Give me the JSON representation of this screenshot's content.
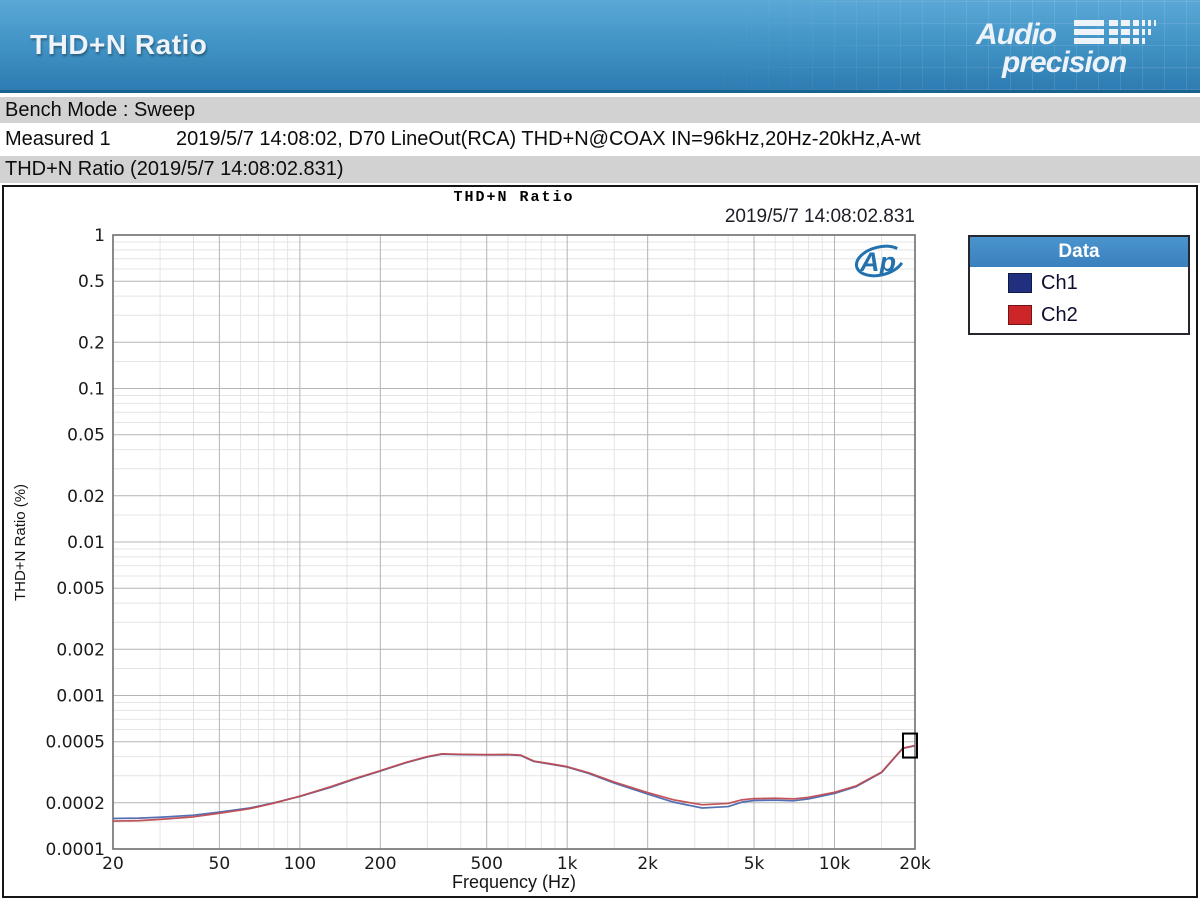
{
  "header": {
    "title": "THD+N Ratio",
    "logo_line1": "Audio",
    "logo_line2": "precision"
  },
  "info_bars": {
    "bench_mode": "Bench Mode : Sweep",
    "measured_label": "Measured 1",
    "measured_text": "2019/5/7 14:08:02, D70 LineOut(RCA) THD+N@COAX IN=96kHz,20Hz-20kHz,A-wt",
    "result_title": "THD+N Ratio (2019/5/7 14:08:02.831)"
  },
  "chart": {
    "title": "THD+N Ratio",
    "timestamp": "2019/5/7 14:08:02.831",
    "watermark": "Ap",
    "legend": {
      "header": "Data",
      "items": [
        {
          "label": "Ch1",
          "color": "#20307f"
        },
        {
          "label": "Ch2",
          "color": "#cc2629"
        }
      ]
    }
  },
  "chart_data": {
    "type": "line",
    "title": "THD+N Ratio",
    "xlabel": "Frequency (Hz)",
    "ylabel": "THD+N Ratio (%)",
    "x_scale": "log",
    "y_scale": "log",
    "xlim": [
      20,
      20000
    ],
    "ylim": [
      0.0001,
      1
    ],
    "grid": "major+minor",
    "legend_position": "top-right",
    "x_ticks": [
      20,
      50,
      100,
      200,
      500,
      1000,
      2000,
      5000,
      10000,
      20000
    ],
    "x_tick_labels": [
      "20",
      "50",
      "100",
      "200",
      "500",
      "1k",
      "2k",
      "5k",
      "10k",
      "20k"
    ],
    "y_ticks": [
      1,
      0.5,
      0.2,
      0.1,
      0.05,
      0.02,
      0.01,
      0.005,
      0.002,
      0.001,
      0.0005,
      0.0002,
      0.0001
    ],
    "y_tick_labels": [
      "1",
      "0.5",
      "0.2",
      "0.1",
      "0.05",
      "0.02",
      "0.01",
      "0.005",
      "0.002",
      "0.001",
      "0.0005",
      "0.0002",
      "0.0001"
    ],
    "x": [
      20,
      25,
      30,
      40,
      50,
      65,
      80,
      100,
      130,
      160,
      200,
      250,
      300,
      340,
      400,
      500,
      600,
      670,
      750,
      860,
      1000,
      1200,
      1500,
      2000,
      2500,
      3200,
      4000,
      4500,
      5000,
      6000,
      7000,
      8000,
      10000,
      12000,
      15000,
      18000,
      20000
    ],
    "series": [
      {
        "name": "Ch1",
        "color": "#4a68b0",
        "values": [
          0.000158,
          0.000159,
          0.000161,
          0.000166,
          0.000174,
          0.000185,
          0.0002,
          0.00022,
          0.000252,
          0.000285,
          0.000322,
          0.000365,
          0.000398,
          0.000415,
          0.000412,
          0.00041,
          0.000411,
          0.000407,
          0.000372,
          0.000358,
          0.000342,
          0.000311,
          0.000269,
          0.000228,
          0.000202,
          0.000185,
          0.000189,
          0.000202,
          0.000207,
          0.000208,
          0.000206,
          0.000212,
          0.00023,
          0.000254,
          0.000315,
          0.000452,
          0.00047
        ]
      },
      {
        "name": "Ch2",
        "color": "#bf4a50",
        "values": [
          0.000152,
          0.000153,
          0.000156,
          0.000162,
          0.000171,
          0.000183,
          0.000199,
          0.000221,
          0.000254,
          0.000287,
          0.000324,
          0.000367,
          0.0004,
          0.000417,
          0.000414,
          0.000412,
          0.000413,
          0.000409,
          0.000374,
          0.00036,
          0.000344,
          0.000314,
          0.000273,
          0.000233,
          0.000209,
          0.000194,
          0.000198,
          0.000209,
          0.000213,
          0.000214,
          0.000212,
          0.000217,
          0.000234,
          0.000257,
          0.000317,
          0.000454,
          0.000472
        ]
      }
    ],
    "annotations": {
      "end_cursor_at_hz": 20000
    }
  }
}
